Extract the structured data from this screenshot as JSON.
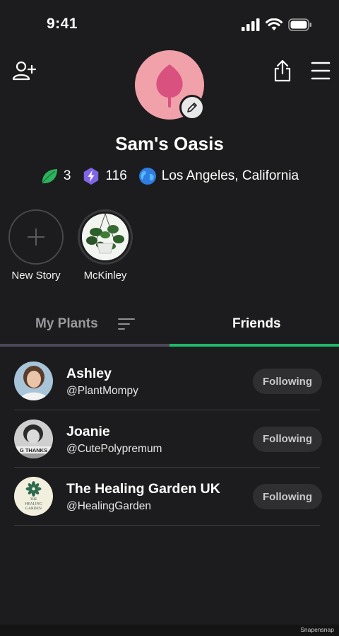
{
  "status_bar": {
    "time": "9:41"
  },
  "header": {
    "add_friend_icon": "person-plus-icon",
    "share_icon": "share-icon",
    "menu_icon": "hamburger-menu-icon"
  },
  "profile": {
    "name": "Sam's Oasis",
    "avatar_icon": "leaf-icon",
    "avatar_color": "#f0a1a9",
    "edit_icon": "pencil-icon",
    "stats": {
      "leaves": "3",
      "energy": "116",
      "location": "Los Angeles, California"
    }
  },
  "stories": [
    {
      "label": "New Story",
      "icon": "plus-icon"
    },
    {
      "label": "McKinley",
      "icon": "potted-plant-photo"
    }
  ],
  "tabs": {
    "my_plants": "My Plants",
    "sort_icon": "sort-icon",
    "friends": "Friends",
    "active": "Friends",
    "accent": "#1fb868"
  },
  "friends": [
    {
      "name": "Ashley",
      "handle": "@PlantMompy",
      "button": "Following"
    },
    {
      "name": "Joanie",
      "handle": "@CutePolypremum",
      "button": "Following",
      "avatar_caption": "G THANKS"
    },
    {
      "name": "The Healing Garden UK",
      "handle": "@HealingGarden",
      "button": "Following",
      "avatar_logo_text": [
        "THE",
        "HEALING",
        "GARDEN"
      ]
    }
  ],
  "watermark": "Snapensnap"
}
